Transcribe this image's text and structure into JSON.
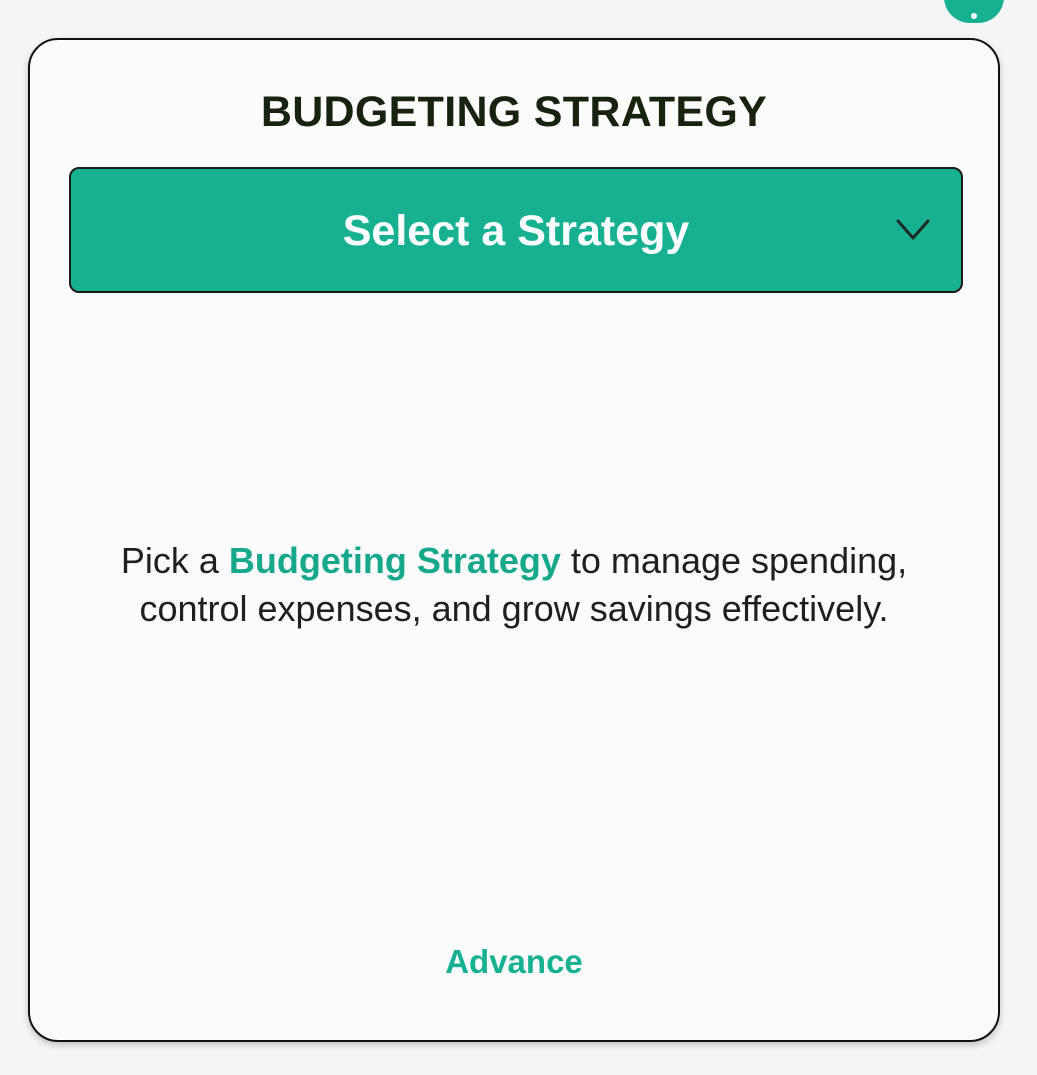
{
  "menu": {
    "icon": "more-vertical-icon"
  },
  "card": {
    "title": "BUDGETING STRATEGY",
    "dropdown": {
      "selected_label": "Select a Strategy",
      "icon": "chevron-down-icon"
    },
    "description": {
      "prefix": "Pick a ",
      "highlight": "Budgeting Strategy",
      "suffix": " to manage spending, control expenses, and grow savings effectively."
    },
    "advance_label": "Advance"
  },
  "colors": {
    "accent": "#17b192",
    "title_text": "#17220f",
    "card_background": "#fbfbfb"
  }
}
